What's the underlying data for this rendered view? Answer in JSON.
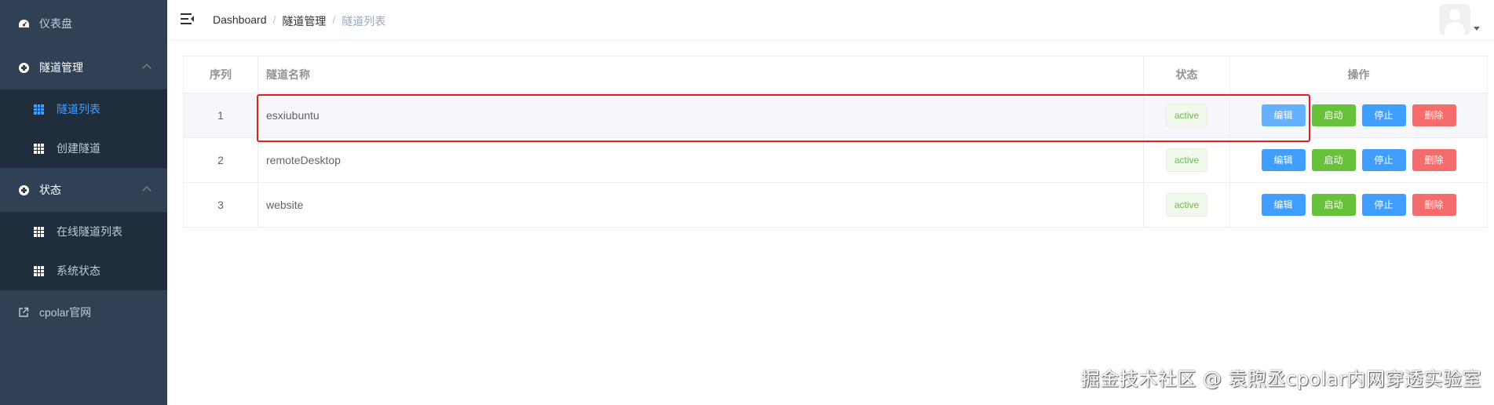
{
  "sidebar": {
    "items": [
      {
        "label": "仪表盘",
        "icon": "dashboard-gauge-icon"
      },
      {
        "label": "隧道管理",
        "icon": "plus-circle-icon",
        "expanded": true,
        "children": [
          {
            "label": "隧道列表",
            "icon": "grid-icon",
            "active": true
          },
          {
            "label": "创建隧道",
            "icon": "grid-icon"
          }
        ]
      },
      {
        "label": "状态",
        "icon": "plus-circle-icon",
        "expanded": true,
        "children": [
          {
            "label": "在线隧道列表",
            "icon": "grid-icon"
          },
          {
            "label": "系统状态",
            "icon": "grid-icon"
          }
        ]
      },
      {
        "label": "cpolar官网",
        "icon": "external-link-icon"
      }
    ]
  },
  "navbar": {
    "breadcrumb": [
      "Dashboard",
      "隧道管理",
      "隧道列表"
    ],
    "separator": "/"
  },
  "table": {
    "headers": {
      "index": "序列",
      "name": "隧道名称",
      "status": "状态",
      "ops": "操作"
    },
    "rows": [
      {
        "index": "1",
        "name": "esxiubuntu",
        "status": "active"
      },
      {
        "index": "2",
        "name": "remoteDesktop",
        "status": "active"
      },
      {
        "index": "3",
        "name": "website",
        "status": "active"
      }
    ],
    "actions": {
      "edit": "编辑",
      "start": "启动",
      "stop": "停止",
      "delete": "删除"
    }
  },
  "watermark": "掘金技术社区 @ 袁煦丞cpolar内网穿透实验室",
  "colors": {
    "sidebar_bg": "#304156",
    "submenu_bg": "#1f2d3d",
    "active": "#409eff",
    "success": "#67c23a",
    "danger": "#f56c6c",
    "highlight": "#e02020"
  }
}
